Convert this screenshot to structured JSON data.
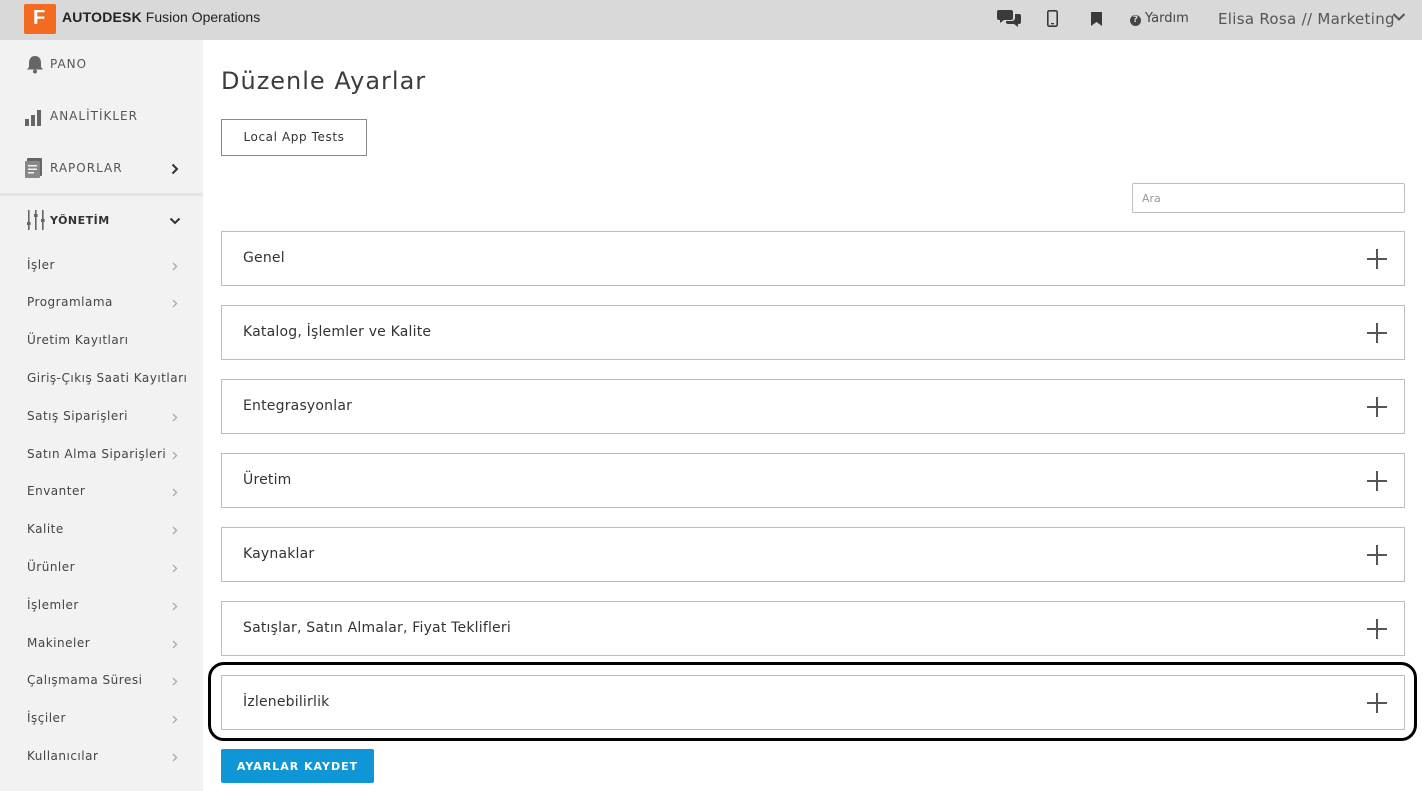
{
  "app": {
    "logo_letter": "F",
    "brand_bold": "AUTODESK",
    "brand_rest": " Fusion Operations",
    "brand_color": "#f26b21"
  },
  "topbar": {
    "icons": [
      "chat-icon",
      "mobile-icon",
      "bookmark-icon"
    ],
    "help_label": "Yardım",
    "user_label": "Elisa Rosa // Marketing"
  },
  "sidebar": {
    "sections": [
      {
        "label": "PANO",
        "icon": "bell-icon"
      },
      {
        "label": "ANALİTİKLER",
        "icon": "bar-chart-icon"
      },
      {
        "label": "RAPORLAR",
        "icon": "report-icon"
      },
      {
        "label": "YÖNETİM",
        "icon": "sliders-icon"
      }
    ],
    "items": [
      {
        "label": "İşler"
      },
      {
        "label": "Programlama"
      },
      {
        "label": "Üretim Kayıtları"
      },
      {
        "label": "Giriş-Çıkış Saati Kayıtları"
      },
      {
        "label": "Satış Siparişleri"
      },
      {
        "label": "Satın Alma Siparişleri"
      },
      {
        "label": "Envanter"
      },
      {
        "label": "Kalite"
      },
      {
        "label": "Ürünler"
      },
      {
        "label": "İşlemler"
      },
      {
        "label": "Makineler"
      },
      {
        "label": "Çalışmama Süresi"
      },
      {
        "label": "İşçiler"
      },
      {
        "label": "Kullanıcılar"
      }
    ]
  },
  "main": {
    "title": "Düzenle Ayarlar",
    "tab_label": "Local App Tests",
    "search_placeholder": "Ara",
    "panels": [
      {
        "label": "Genel"
      },
      {
        "label": "Katalog, İşlemler ve Kalite"
      },
      {
        "label": "Entegrasyonlar"
      },
      {
        "label": "Üretim"
      },
      {
        "label": "Kaynaklar"
      },
      {
        "label": "Satışlar, Satın Almalar, Fiyat Teklifleri"
      },
      {
        "label": "İzlenebilirlik"
      }
    ],
    "save_label": "AYARLAR KAYDET",
    "save_color": "#0f96d6"
  }
}
